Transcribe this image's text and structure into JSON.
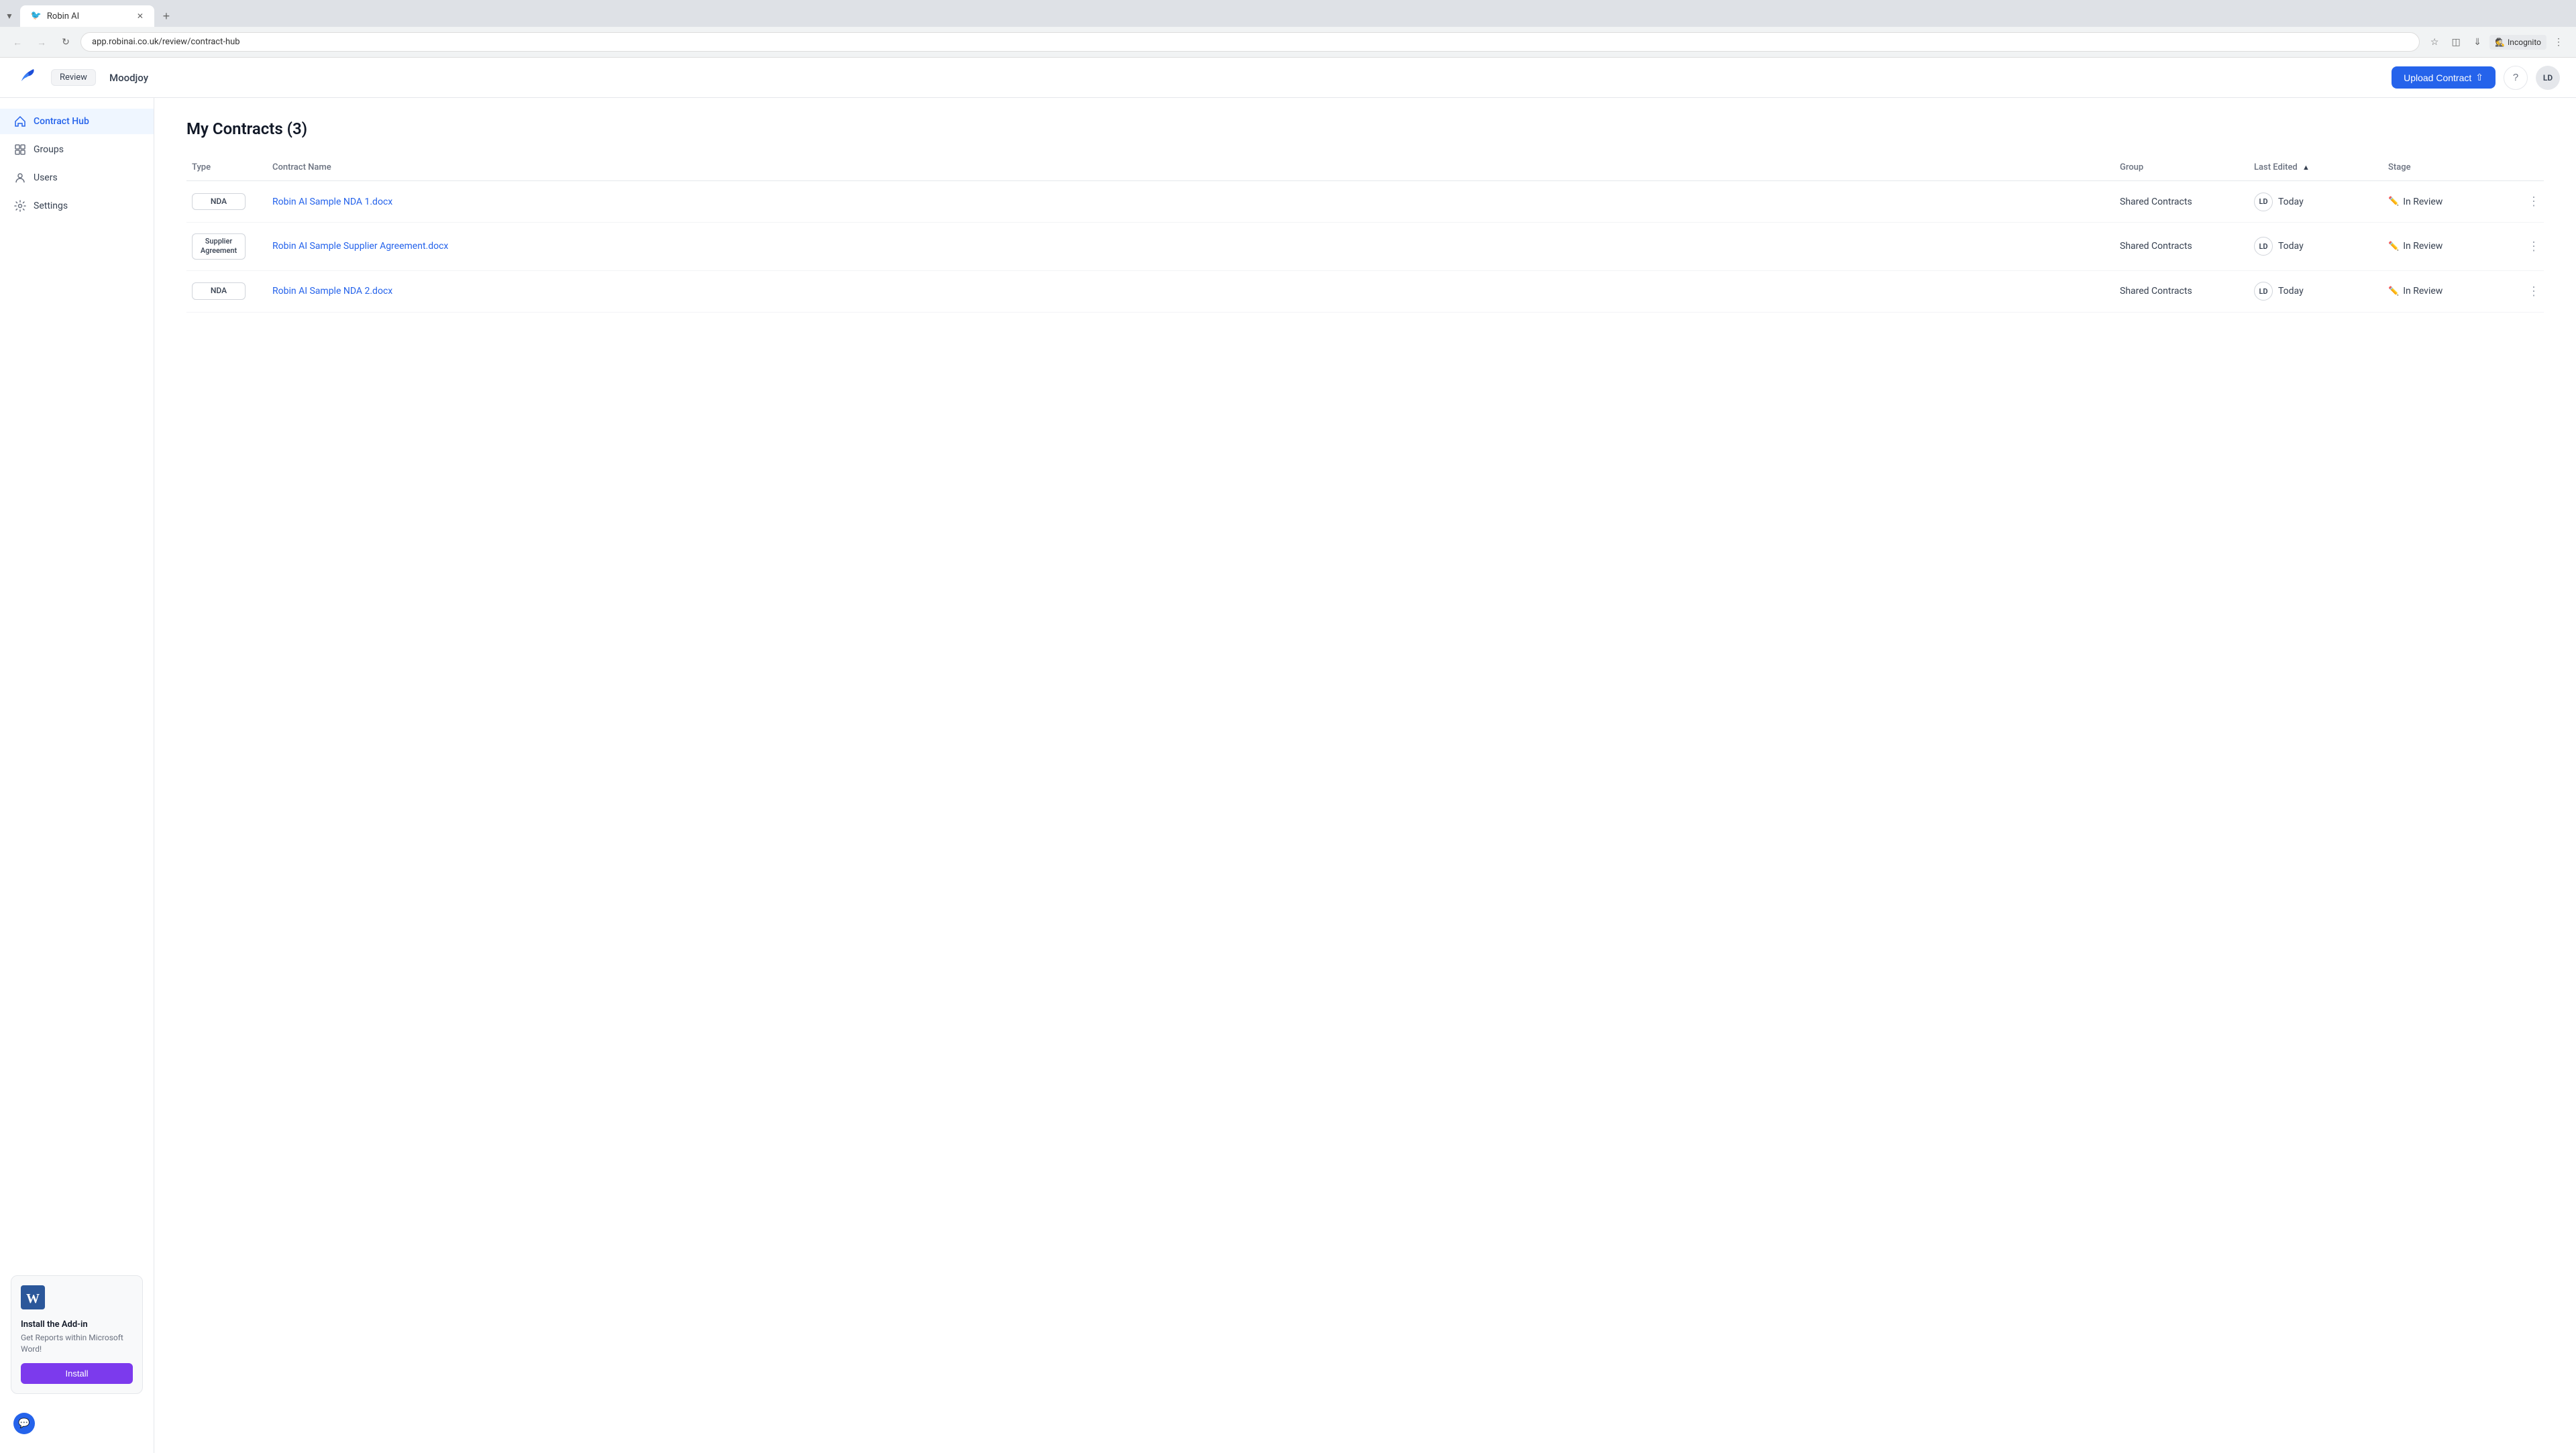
{
  "browser": {
    "tabs": [
      {
        "id": "tab1",
        "title": "Robin AI",
        "active": true,
        "icon": "🐦"
      }
    ],
    "address": "app.robinai.co.uk/review/contract-hub",
    "incognito_label": "Incognito"
  },
  "header": {
    "logo_alt": "Robin AI Logo",
    "review_label": "Review",
    "company": "Moodjoy",
    "upload_button": "Upload Contract",
    "help_label": "?",
    "user_initials": "LD"
  },
  "sidebar": {
    "items": [
      {
        "id": "contract-hub",
        "label": "Contract Hub",
        "active": true,
        "icon": "home"
      },
      {
        "id": "groups",
        "label": "Groups",
        "active": false,
        "icon": "grid"
      },
      {
        "id": "users",
        "label": "Users",
        "active": false,
        "icon": "user"
      },
      {
        "id": "settings",
        "label": "Settings",
        "active": false,
        "icon": "settings"
      }
    ],
    "addin": {
      "title": "Install the Add-in",
      "description": "Get Reports within Microsoft Word!",
      "install_label": "Install"
    }
  },
  "main": {
    "page_title": "My Contracts (3)",
    "table": {
      "columns": [
        {
          "id": "type",
          "label": "Type"
        },
        {
          "id": "contract_name",
          "label": "Contract Name"
        },
        {
          "id": "group",
          "label": "Group"
        },
        {
          "id": "last_edited",
          "label": "Last Edited",
          "sorted": true,
          "sort_dir": "asc"
        },
        {
          "id": "stage",
          "label": "Stage"
        },
        {
          "id": "actions",
          "label": ""
        }
      ],
      "rows": [
        {
          "type": "NDA",
          "contract_name": "Robin AI Sample NDA 1.docx",
          "group": "Shared Contracts",
          "avatar": "LD",
          "last_edited": "Today",
          "stage": "In Review"
        },
        {
          "type": "Supplier Agreement",
          "contract_name": "Robin AI Sample Supplier Agreement.docx",
          "group": "Shared Contracts",
          "avatar": "LD",
          "last_edited": "Today",
          "stage": "In Review"
        },
        {
          "type": "NDA",
          "contract_name": "Robin AI Sample NDA 2.docx",
          "group": "Shared Contracts",
          "avatar": "LD",
          "last_edited": "Today",
          "stage": "In Review"
        }
      ]
    }
  }
}
